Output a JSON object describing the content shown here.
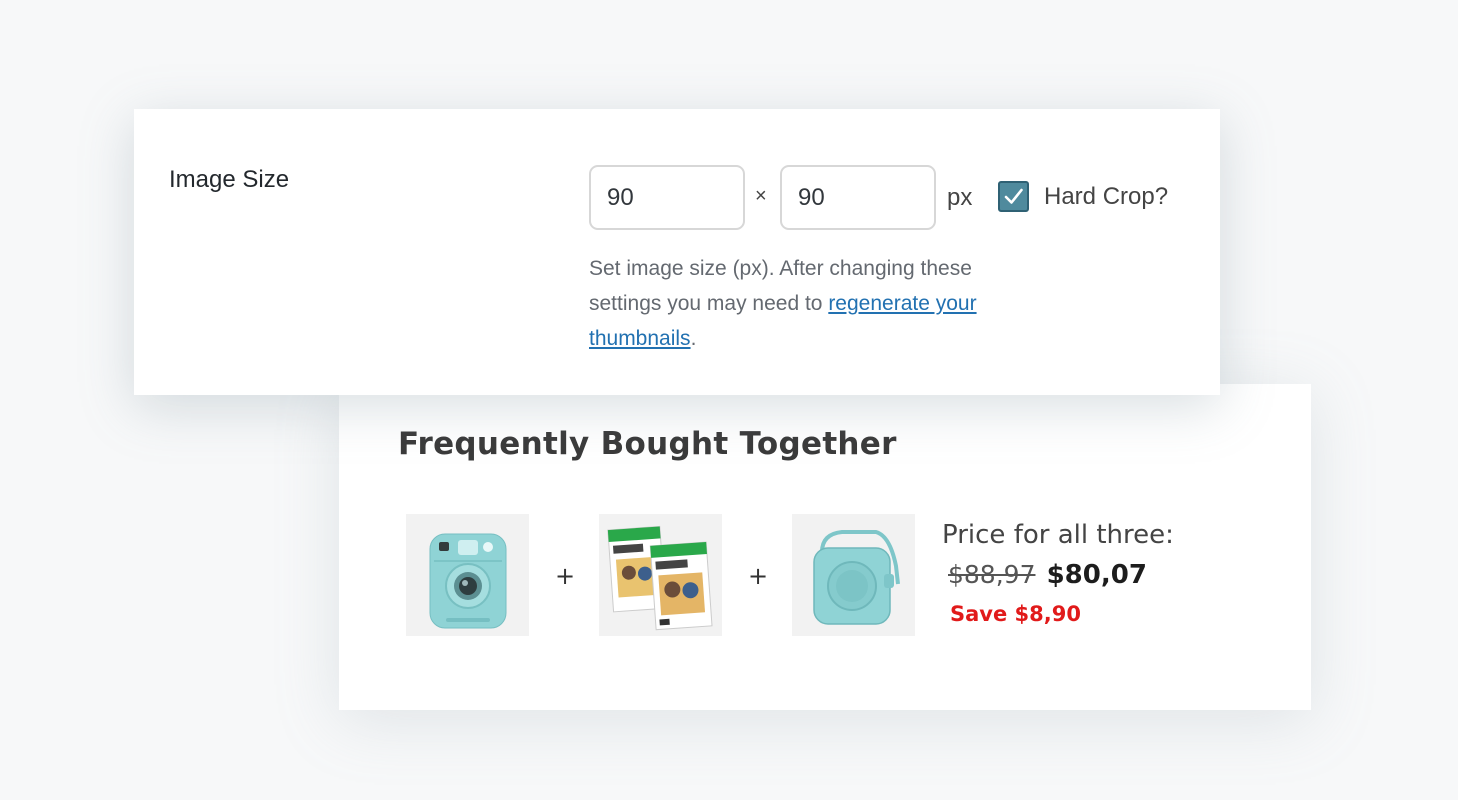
{
  "image_size": {
    "label": "Image Size",
    "width_value": "90",
    "height_value": "90",
    "separator": "×",
    "unit": "px",
    "hard_crop": {
      "label": "Hard Crop?",
      "checked": true
    },
    "help": {
      "text_before": "Set image size (px). After changing these settings you may need to ",
      "link_text": "regenerate your thumbnails",
      "text_after": "."
    }
  },
  "frequently_bought": {
    "title": "Frequently Bought Together",
    "products": [
      {
        "icon": "instant-camera-image"
      },
      {
        "icon": "instant-film-pack-image"
      },
      {
        "icon": "camera-case-image"
      }
    ],
    "plus_sign": "+",
    "price_label": "Price for all three:",
    "old_price": "$88,97",
    "new_price": "$80,07",
    "save_text": "Save $8,90"
  },
  "colors": {
    "checkbox": "#4f8a9d",
    "link": "#2271b1",
    "save": "#e11a1a",
    "product_mint": "#8fd3d5"
  }
}
